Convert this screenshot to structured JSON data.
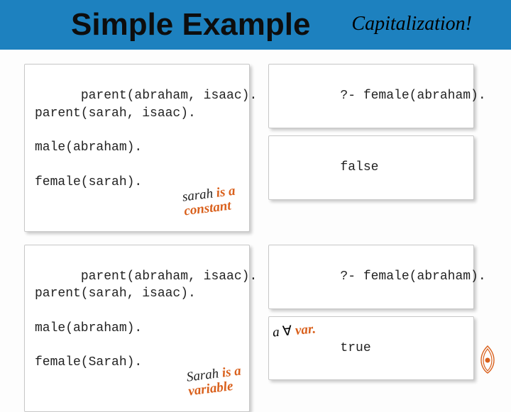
{
  "header": {
    "title": "Simple Example",
    "annotation": "Capitalization!"
  },
  "top": {
    "code_left": "parent(abraham, isaac).\nparent(sarah, isaac).\n\nmale(abraham).\n\nfemale(sarah).",
    "query": "?- female(abraham).",
    "result": "false",
    "annot_line1": "sarah ",
    "annot_hl1": "is a",
    "annot_hl2": "constant"
  },
  "bottom": {
    "code_left": "parent(abraham, isaac).\nparent(sarah, isaac).\n\nmale(abraham).\n\nfemale(Sarah).",
    "query": "?- female(abraham).",
    "result": "true",
    "annot_line1": "Sarah ",
    "annot_hl1": "is a",
    "annot_hl2": "variable",
    "var_prefix": "a ",
    "var_sym": "∀",
    "var_hl": " var."
  }
}
